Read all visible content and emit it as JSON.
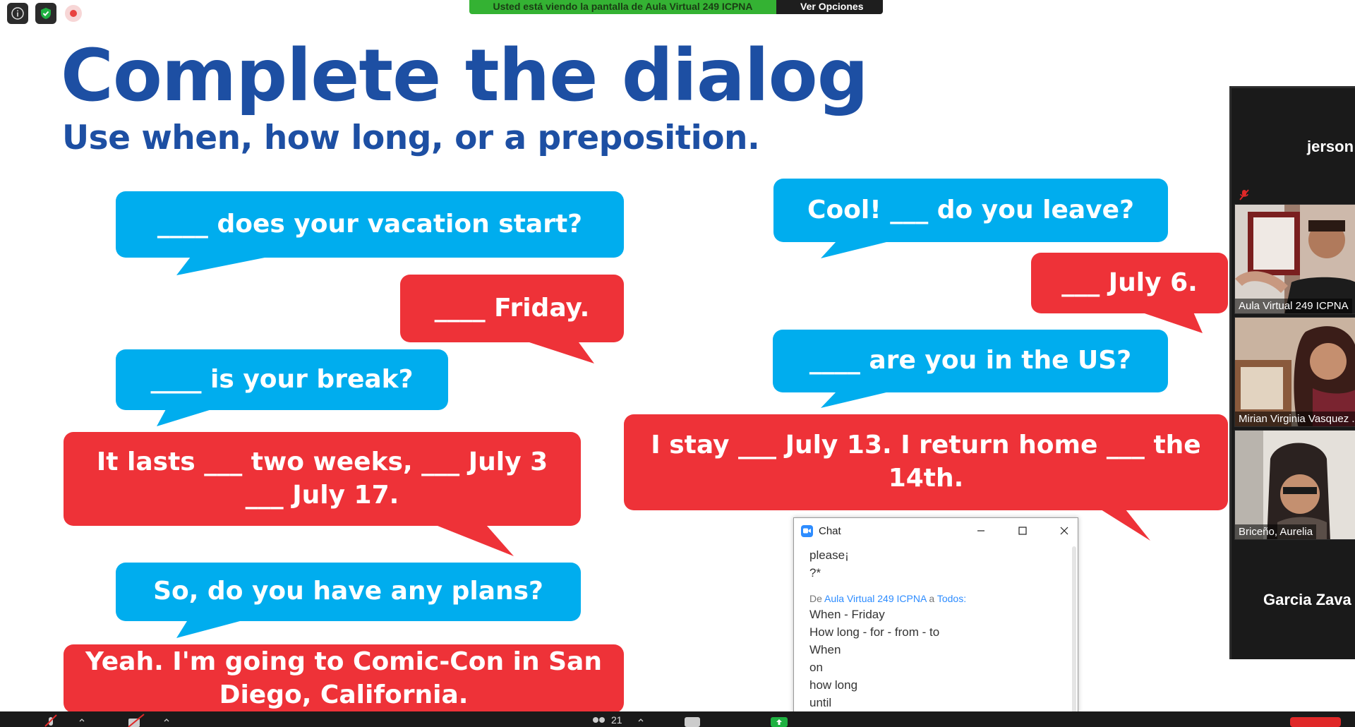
{
  "share_banner": {
    "text": "Usted está viendo la pantalla de Aula Virtual 249 ICPNA",
    "options_label": "Ver Opciones ⌄"
  },
  "slide": {
    "title": "Complete the dialog",
    "subtitle": "Use when, how long, or a preposition.",
    "bubbles": [
      "____ does your vacation start?",
      "____ Friday.",
      "____ is your break?",
      "It lasts ___ two weeks, ___ July 3 ___ July 17.",
      "So, do you have any plans?",
      "Yeah. I'm going to Comic-Con in San Diego, California.",
      "Cool! ___ do you leave?",
      "___ July 6.",
      "____ are you in the US?",
      "I stay ___ July 13. I return home ___ the 14th."
    ],
    "colors": {
      "blue": "#00adee",
      "red": "#ee3238",
      "title": "#1d4fa3"
    }
  },
  "participants": {
    "top_name": "jerson",
    "tiles": [
      {
        "label": "Aula Virtual 249 ICPNA"
      },
      {
        "label": "Mirian Virginia Vasquez ..."
      },
      {
        "label": "Briceño, Aurelia"
      }
    ],
    "bottom_name": "Garcia  Zava"
  },
  "chat": {
    "title": "Chat",
    "lines_before": [
      "please¡",
      "?*"
    ],
    "meta_from": "De",
    "meta_sender": "Aula Virtual 249 ICPNA",
    "meta_to": "a",
    "meta_recipient": "Todos:",
    "messages": [
      "When - Friday",
      "How long - for - from - to",
      "When",
      "on",
      "how long",
      "until"
    ]
  },
  "toolbar": {
    "participants_count": "21"
  }
}
